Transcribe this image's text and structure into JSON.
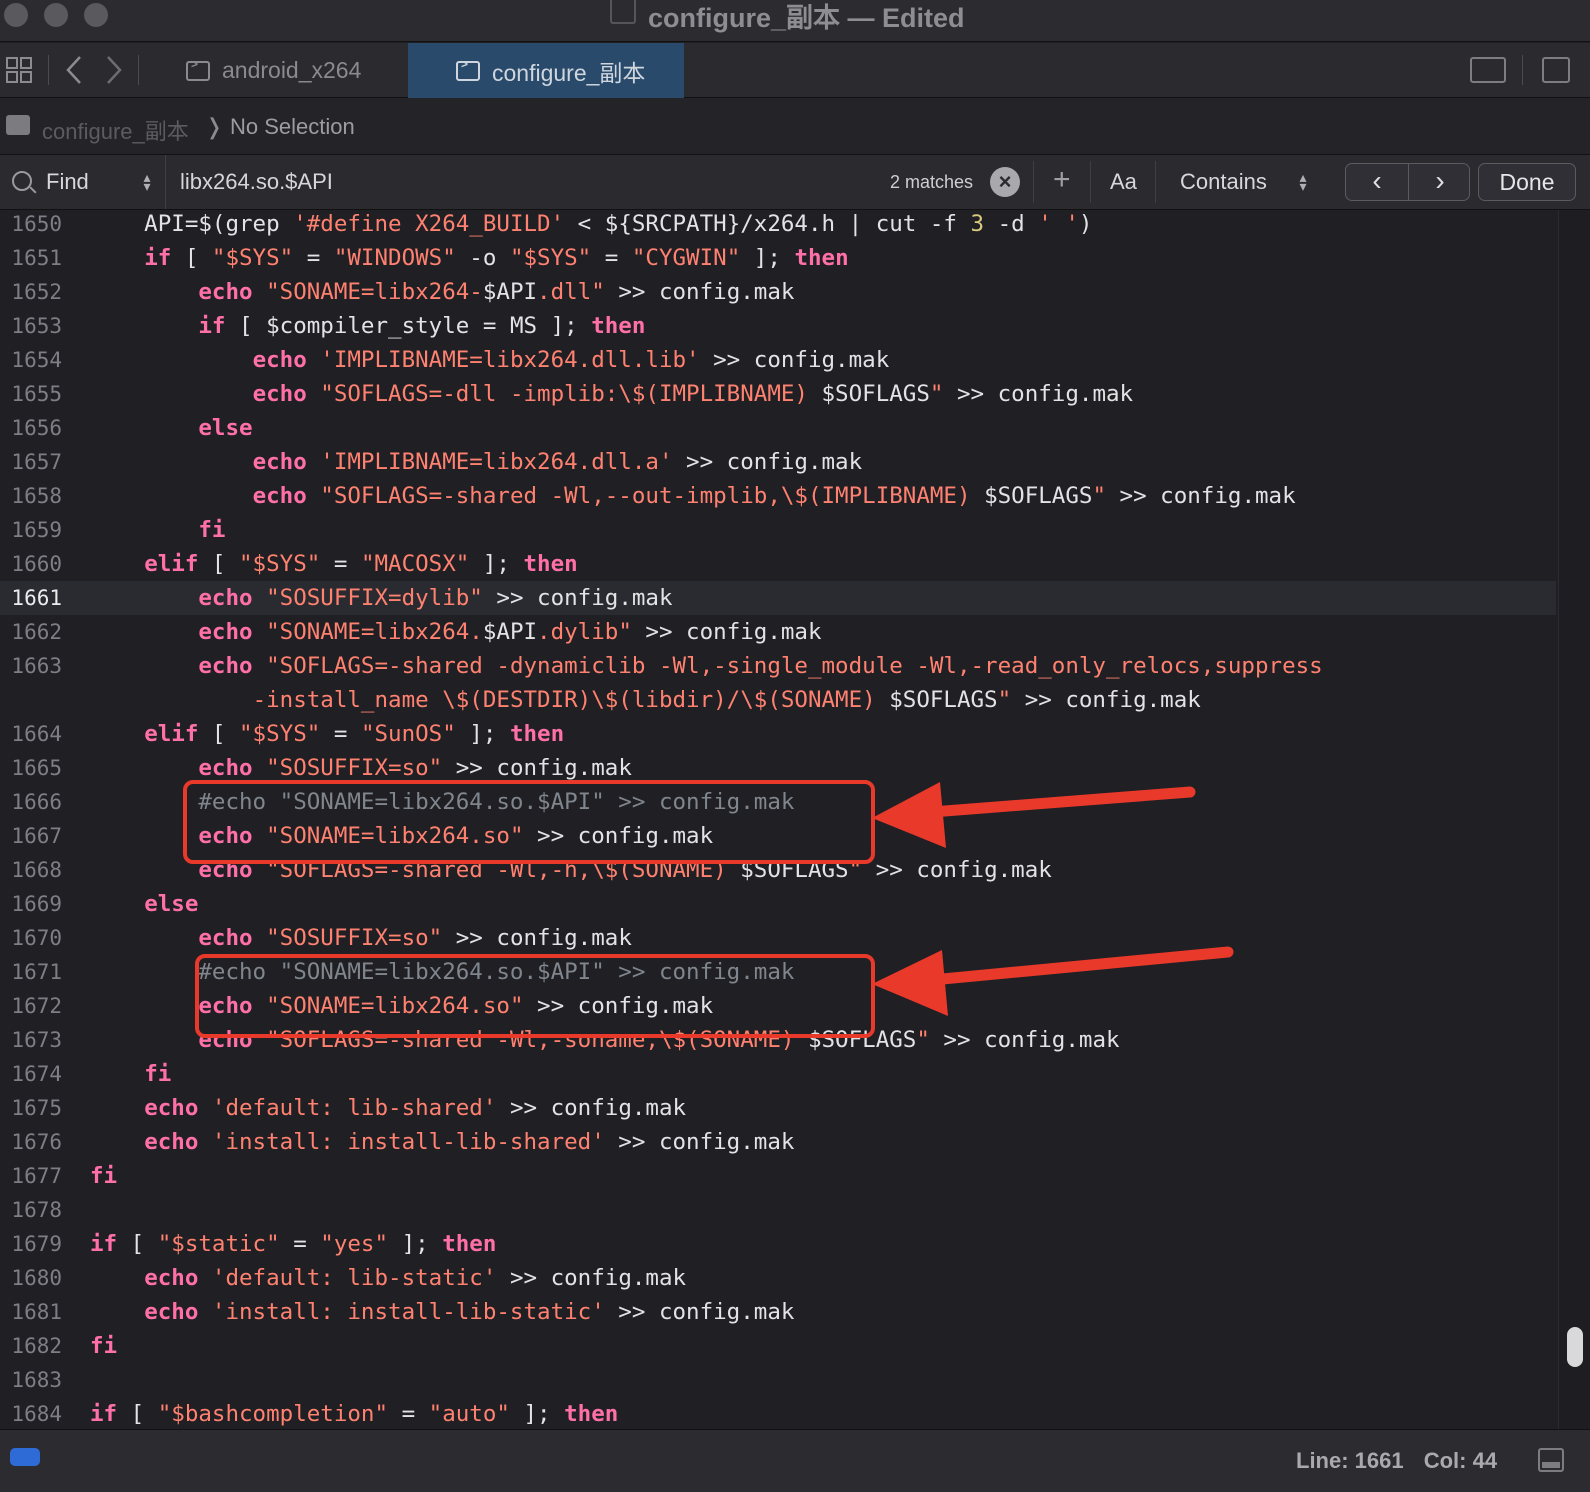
{
  "window": {
    "title": "configure_副本 — Edited"
  },
  "tabs": [
    {
      "label": "android_x264",
      "active": false
    },
    {
      "label": "configure_副本",
      "active": true
    }
  ],
  "jumpbar": {
    "file": "configure_副本",
    "separator": "❭",
    "selection": "No Selection"
  },
  "find": {
    "mode": "Find",
    "query": "libx264.so.$API",
    "match_count": "2 matches",
    "add_label": "+",
    "case_label": "Aa",
    "match_type": "Contains",
    "prev_label": "‹",
    "next_label": "›",
    "done_label": "Done"
  },
  "editor": {
    "current_line": 1661,
    "lines": [
      {
        "num": "1650",
        "html": "    API=$(grep <span class=\"s\">'#define X264_BUILD'</span> &lt; ${SRCPATH}/x264.h | cut -f <span class=\"n\">3</span> -d <span class=\"s\">' '</span>)"
      },
      {
        "num": "1651",
        "html": "    <span class=\"k\">if</span> [ <span class=\"s\">\"$SYS\"</span> = <span class=\"s\">\"WINDOWS\"</span> -o <span class=\"s\">\"$SYS\"</span> = <span class=\"s\">\"CYGWIN\"</span> ]; <span class=\"k\">then</span>"
      },
      {
        "num": "1652",
        "html": "        <span class=\"k\">echo</span> <span class=\"s\">\"SONAME=libx264-</span>$API<span class=\"s\">.dll\"</span> &gt;&gt; config.mak"
      },
      {
        "num": "1653",
        "html": "        <span class=\"k\">if</span> [ $compiler_style = MS ]; <span class=\"k\">then</span>"
      },
      {
        "num": "1654",
        "html": "            <span class=\"k\">echo</span> <span class=\"s\">'IMPLIBNAME=libx264.dll.lib'</span> &gt;&gt; config.mak"
      },
      {
        "num": "1655",
        "html": "            <span class=\"k\">echo</span> <span class=\"s\">\"SOFLAGS=-dll -implib:\\$(IMPLIBNAME) </span>$SOFLAGS<span class=\"s\">\"</span> &gt;&gt; config.mak"
      },
      {
        "num": "1656",
        "html": "        <span class=\"k\">else</span>"
      },
      {
        "num": "1657",
        "html": "            <span class=\"k\">echo</span> <span class=\"s\">'IMPLIBNAME=libx264.dll.a'</span> &gt;&gt; config.mak"
      },
      {
        "num": "1658",
        "html": "            <span class=\"k\">echo</span> <span class=\"s\">\"SOFLAGS=-shared -Wl,--out-implib,\\$(IMPLIBNAME) </span>$SOFLAGS<span class=\"s\">\"</span> &gt;&gt; config.mak"
      },
      {
        "num": "1659",
        "html": "        <span class=\"k\">fi</span>"
      },
      {
        "num": "1660",
        "html": "    <span class=\"k\">elif</span> [ <span class=\"s\">\"$SYS\"</span> = <span class=\"s\">\"MACOSX\"</span> ]; <span class=\"k\">then</span>"
      },
      {
        "num": "1661",
        "html": "        <span class=\"k\">echo</span> <span class=\"s\">\"SOSUFFIX=dylib\"</span> &gt;&gt; config.mak"
      },
      {
        "num": "1662",
        "html": "        <span class=\"k\">echo</span> <span class=\"s\">\"SONAME=libx264.</span>$API<span class=\"s\">.dylib\"</span> &gt;&gt; config.mak"
      },
      {
        "num": "1663",
        "html": "        <span class=\"k\">echo</span> <span class=\"s\">\"SOFLAGS=-shared -dynamiclib -Wl,-single_module -Wl,-read_only_relocs,suppress</span>"
      },
      {
        "num": "",
        "html": "            <span class=\"s\">-install_name \\$(DESTDIR)\\$(libdir)/\\$(SONAME) </span>$SOFLAGS<span class=\"s\">\"</span> &gt;&gt; config.mak"
      },
      {
        "num": "1664",
        "html": "    <span class=\"k\">elif</span> [ <span class=\"s\">\"$SYS\"</span> = <span class=\"s\">\"SunOS\"</span> ]; <span class=\"k\">then</span>"
      },
      {
        "num": "1665",
        "html": "        <span class=\"k\">echo</span> <span class=\"s\">\"SOSUFFIX=so\"</span> &gt;&gt; config.mak"
      },
      {
        "num": "1666",
        "html": "        <span class=\"c\">#echo \"SONAME=libx264.so.$API\" &gt;&gt; config.mak</span>"
      },
      {
        "num": "1667",
        "html": "        <span class=\"k\">echo</span> <span class=\"s\">\"SONAME=libx264.so\"</span> &gt;&gt; config.mak"
      },
      {
        "num": "1668",
        "html": "        <span class=\"k\">echo</span> <span class=\"s\">\"SOFLAGS=-shared -Wl,-h,\\$(SONAME) </span>$SOFLAGS<span class=\"s\">\"</span> &gt;&gt; config.mak"
      },
      {
        "num": "1669",
        "html": "    <span class=\"k\">else</span>"
      },
      {
        "num": "1670",
        "html": "        <span class=\"k\">echo</span> <span class=\"s\">\"SOSUFFIX=so\"</span> &gt;&gt; config.mak"
      },
      {
        "num": "1671",
        "html": "        <span class=\"c\">#echo \"SONAME=libx264.so.$API\" &gt;&gt; config.mak</span>"
      },
      {
        "num": "1672",
        "html": "        <span class=\"k\">echo</span> <span class=\"s\">\"SONAME=libx264.so\"</span> &gt;&gt; config.mak"
      },
      {
        "num": "1673",
        "html": "        <span class=\"k\">echo</span> <span class=\"s\">\"SOFLAGS=-shared -Wl,-soname,\\$(SONAME) </span>$SOFLAGS<span class=\"s\">\"</span> &gt;&gt; config.mak"
      },
      {
        "num": "1674",
        "html": "    <span class=\"k\">fi</span>"
      },
      {
        "num": "1675",
        "html": "    <span class=\"k\">echo</span> <span class=\"s\">'default: lib-shared'</span> &gt;&gt; config.mak"
      },
      {
        "num": "1676",
        "html": "    <span class=\"k\">echo</span> <span class=\"s\">'install: install-lib-shared'</span> &gt;&gt; config.mak"
      },
      {
        "num": "1677",
        "html": "<span class=\"k\">fi</span>"
      },
      {
        "num": "1678",
        "html": ""
      },
      {
        "num": "1679",
        "html": "<span class=\"k\">if</span> [ <span class=\"s\">\"$static\"</span> = <span class=\"s\">\"yes\"</span> ]; <span class=\"k\">then</span>"
      },
      {
        "num": "1680",
        "html": "    <span class=\"k\">echo</span> <span class=\"s\">'default: lib-static'</span> &gt;&gt; config.mak"
      },
      {
        "num": "1681",
        "html": "    <span class=\"k\">echo</span> <span class=\"s\">'install: install-lib-static'</span> &gt;&gt; config.mak"
      },
      {
        "num": "1682",
        "html": "<span class=\"k\">fi</span>"
      },
      {
        "num": "1683",
        "html": ""
      },
      {
        "num": "1684",
        "html": "<span class=\"k\">if</span> [ <span class=\"s\">\"$bashcompletion\"</span> = <span class=\"s\">\"auto\"</span> ]; <span class=\"k\">then</span>"
      }
    ]
  },
  "status": {
    "line": "Line: 1661",
    "col": "Col: 44"
  },
  "colors": {
    "keyword": "#ff6fa8",
    "string": "#ff8170",
    "number": "#d9c97c",
    "comment": "#80868d",
    "annotation": "#e8392a",
    "active_tab": "#294a6b"
  },
  "icons": [
    "grid-icon",
    "back-icon",
    "forward-icon",
    "terminal-icon",
    "search-icon",
    "clear-icon",
    "add-icon",
    "split-editor-icon",
    "new-editor-icon",
    "panel-toggle-icon"
  ]
}
